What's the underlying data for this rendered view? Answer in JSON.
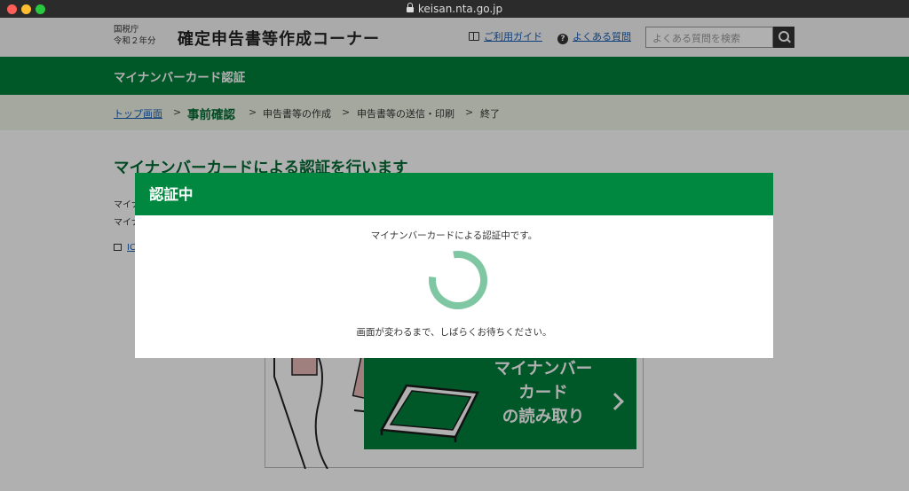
{
  "browser": {
    "url": "keisan.nta.go.jp"
  },
  "header": {
    "agency_name": "国税庁",
    "year": "令和２年分",
    "title": "確定申告書等作成コーナー",
    "guide_link": "ご利用ガイド",
    "faq_link": "よくある質問",
    "search_placeholder": "よくある質問を検索"
  },
  "section_title": "マイナンバーカード認証",
  "breadcrumb": {
    "items": [
      "トップ画面",
      "事前確認",
      "申告書等の作成",
      "申告書等の送信・印刷",
      "終了"
    ],
    "separator": ">"
  },
  "page": {
    "heading": "マイナンバーカードによる認証を行います",
    "line1_stub": "マイナ",
    "line2_stub": "マイナ",
    "link_stub": "IC",
    "card_button_label": "マイナンバーカードの読み取り",
    "card_button_lines": [
      "マイナンバー",
      "カード",
      "の読み取り"
    ]
  },
  "modal": {
    "title": "認証中",
    "message": "マイナンバーカードによる認証中です。",
    "sub_message": "画面が変わるまで、しばらくお待ちください。"
  },
  "colors": {
    "brand_green": "#007f3b",
    "modal_header": "#008740",
    "spinner": "#7fc7a3",
    "link": "#1a5fb4"
  }
}
